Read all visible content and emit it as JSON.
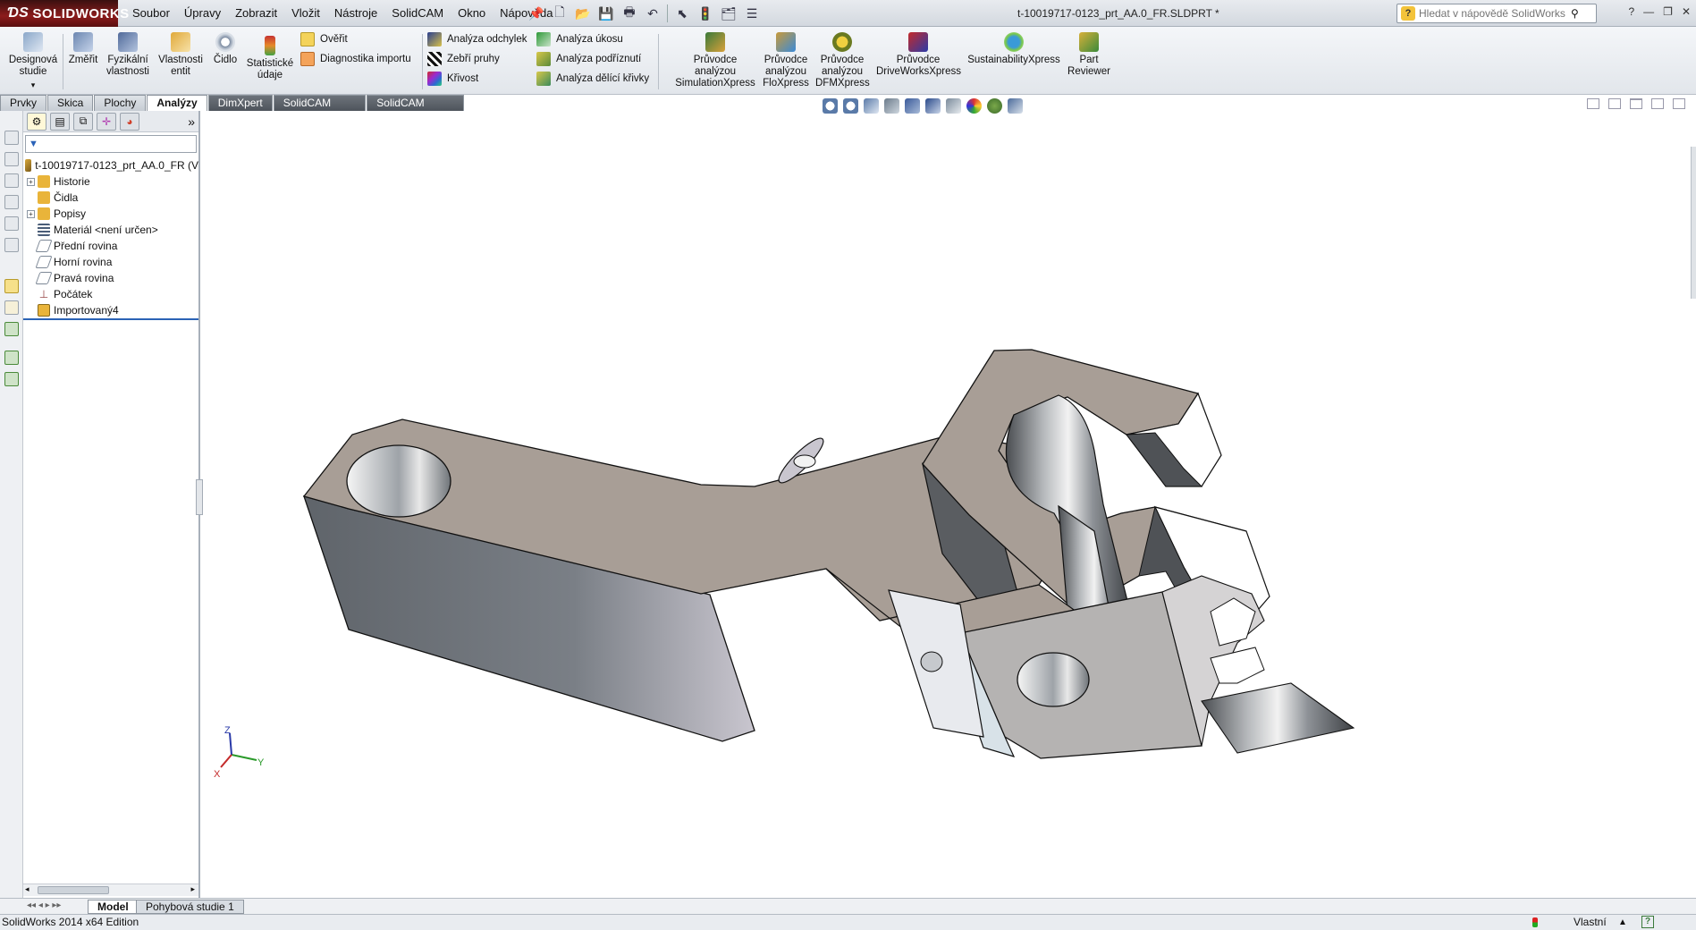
{
  "app": {
    "logo": "SOLIDWORKS",
    "document_title": "t-10019717-0123_prt_AA.0_FR.SLDPRT *"
  },
  "menu": [
    "Soubor",
    "Úpravy",
    "Zobrazit",
    "Vložit",
    "Nástroje",
    "SolidCAM",
    "Okno",
    "Nápověda"
  ],
  "help_search": {
    "placeholder": "Hledat v nápovědě SolidWorks"
  },
  "ribbon": {
    "designova_studie": "Designová studie",
    "zmerit": "Změřit",
    "fyzikalni_vlastnosti": "Fyzikální vlastnosti",
    "vlastnosti_entit": "Vlastnosti entit",
    "cidlo": "Čidlo",
    "statisticke_udaje": "Statistické údaje",
    "overit": "Ověřit",
    "diagnostika_importu": "Diagnostika importu",
    "analyza_odchylek": "Analýza odchylek",
    "zebri_pruhy": "Zebří pruhy",
    "krivost": "Křivost",
    "analyza_ukosu": "Analýza úkosu",
    "analyza_podriznuti": "Analýza podříznutí",
    "analyza_delici_krivky": "Analýza dělící křivky",
    "pruvodce_simulation": "Průvodce analýzou SimulationXpress",
    "pruvodce_flo": "Průvodce analýzou FloXpress",
    "pruvodce_dfm": "Průvodce analýzou DFMXpress",
    "pruvodce_driveworks": "Průvodce DriveWorksXpress",
    "sustainability": "SustainabilityXpress",
    "part_reviewer": "Part Reviewer"
  },
  "tabs": [
    {
      "label": "Prvky",
      "state": "normal"
    },
    {
      "label": "Skica",
      "state": "normal"
    },
    {
      "label": "Plochy",
      "state": "normal"
    },
    {
      "label": "Analýzy",
      "state": "active"
    },
    {
      "label": "DimXpert",
      "state": "dark"
    },
    {
      "label": "SolidCAM Projekt",
      "state": "dark"
    },
    {
      "label": "SolidCAM operace",
      "state": "dark"
    }
  ],
  "tree": {
    "root": "t-10019717-0123_prt_AA.0_FR  (V",
    "items": [
      {
        "label": "Historie",
        "expandable": true,
        "icon_color": "#e9b43a"
      },
      {
        "label": "Čidla",
        "expandable": false,
        "icon_color": "#e9b43a"
      },
      {
        "label": "Popisy",
        "expandable": true,
        "icon_color": "#e9b43a"
      },
      {
        "label": "Materiál <není určen>",
        "expandable": false,
        "icon_color": "#4a5d78"
      },
      {
        "label": "Přední rovina",
        "expandable": false,
        "icon_color": "#7d8896"
      },
      {
        "label": "Horní rovina",
        "expandable": false,
        "icon_color": "#7d8896"
      },
      {
        "label": "Pravá rovina",
        "expandable": false,
        "icon_color": "#7d8896"
      },
      {
        "label": "Počátek",
        "expandable": false,
        "icon_color": "#9a4a4a"
      },
      {
        "label": "Importovaný4",
        "expandable": false,
        "icon_color": "#e9b43a"
      }
    ]
  },
  "triad": {
    "x": "X",
    "y": "Y",
    "z": "Z"
  },
  "bottom_tabs": [
    {
      "label": "Model",
      "state": "active"
    },
    {
      "label": "Pohybová studie 1",
      "state": "normal"
    }
  ],
  "status": {
    "edition": "SolidWorks 2014 x64 Edition",
    "units": "Vlastní",
    "help": "?"
  },
  "colors": {
    "accent_blue": "#2b63b5",
    "brand_red": "#8c1c1c",
    "part_top": "#a89e96",
    "part_side": "#6f7277"
  }
}
